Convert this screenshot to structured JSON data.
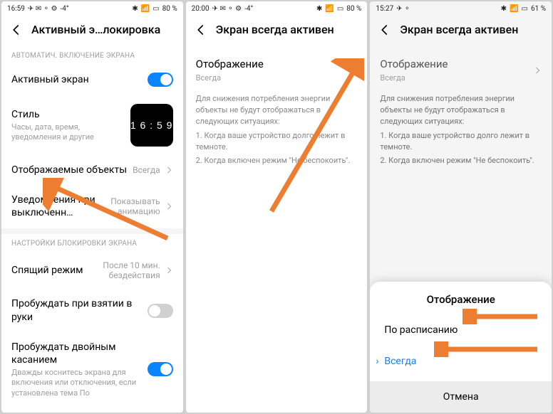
{
  "screen1": {
    "status": {
      "time": "16:59",
      "icons_left": "✈ ✉ ⚬ ⚙",
      "temp": "-4°",
      "battery": "80 %",
      "signal": "📶",
      "bt": "✱"
    },
    "header": {
      "title": "Активный э…локировка"
    },
    "section1": {
      "label": "АВТОМАТИЧ. ВКЛЮЧЕНИЕ ЭКРАНА"
    },
    "active_screen": {
      "label": "Активный экран"
    },
    "style": {
      "label": "Стиль",
      "sub": "Часы, дата, время, уведомления и другие",
      "clock": "1 6 : 5 9"
    },
    "objects": {
      "label": "Отображаемые объекты",
      "value": "Всегда"
    },
    "notif": {
      "label": "Уведомления при выключенн…",
      "value": "Показывать анимацию"
    },
    "section2": {
      "label": "НАСТРОЙКИ БЛОКИРОВКИ ЭКРАНА"
    },
    "sleep": {
      "label": "Спящий режим",
      "value": "После 10 мин. бездействия"
    },
    "wake_pick": {
      "label": "Пробуждать при взятии в руки"
    },
    "wake_double": {
      "label": "Пробуждать двойным касанием",
      "sub": "Дважды коснитесь экрана для включения или отключения, если установлена тема По"
    }
  },
  "screen2": {
    "status": {
      "time": "20:00",
      "icons_left": "✈ ✉ ⚬ ⚙",
      "temp": "-4°",
      "battery": "80 %",
      "signal": "📶",
      "bt": "✱"
    },
    "header": {
      "title": "Экран всегда активен"
    },
    "display": {
      "label": "Отображение",
      "value": "Всегда"
    },
    "info": {
      "intro": "Для снижения потребления энергии объекты не будут отображаться в следующих ситуациях:",
      "line1": "1. Когда ваше устройство долго лежит в темноте.",
      "line2": "2. Когда включен режим \"Не беспокоить\"."
    }
  },
  "screen3": {
    "status": {
      "time": "15:27",
      "icons_left": "✈ ⚬",
      "battery": "61 %",
      "signal": "📶",
      "bt": "✱"
    },
    "header": {
      "title": "Экран всегда активен"
    },
    "display": {
      "label": "Отображение",
      "value": "Всегда"
    },
    "info": {
      "intro": "Для снижения потребления энергии объекты не будут отображаться в следующих ситуациях:",
      "line1": "1. Когда ваше устройство долго лежит в темноте.",
      "line2": "2. Когда включен режим \"Не беспокоить\"."
    },
    "sheet": {
      "title": "Отображение",
      "option1": "По расписанию",
      "option2": "Всегда",
      "cancel": "Отмена"
    }
  }
}
